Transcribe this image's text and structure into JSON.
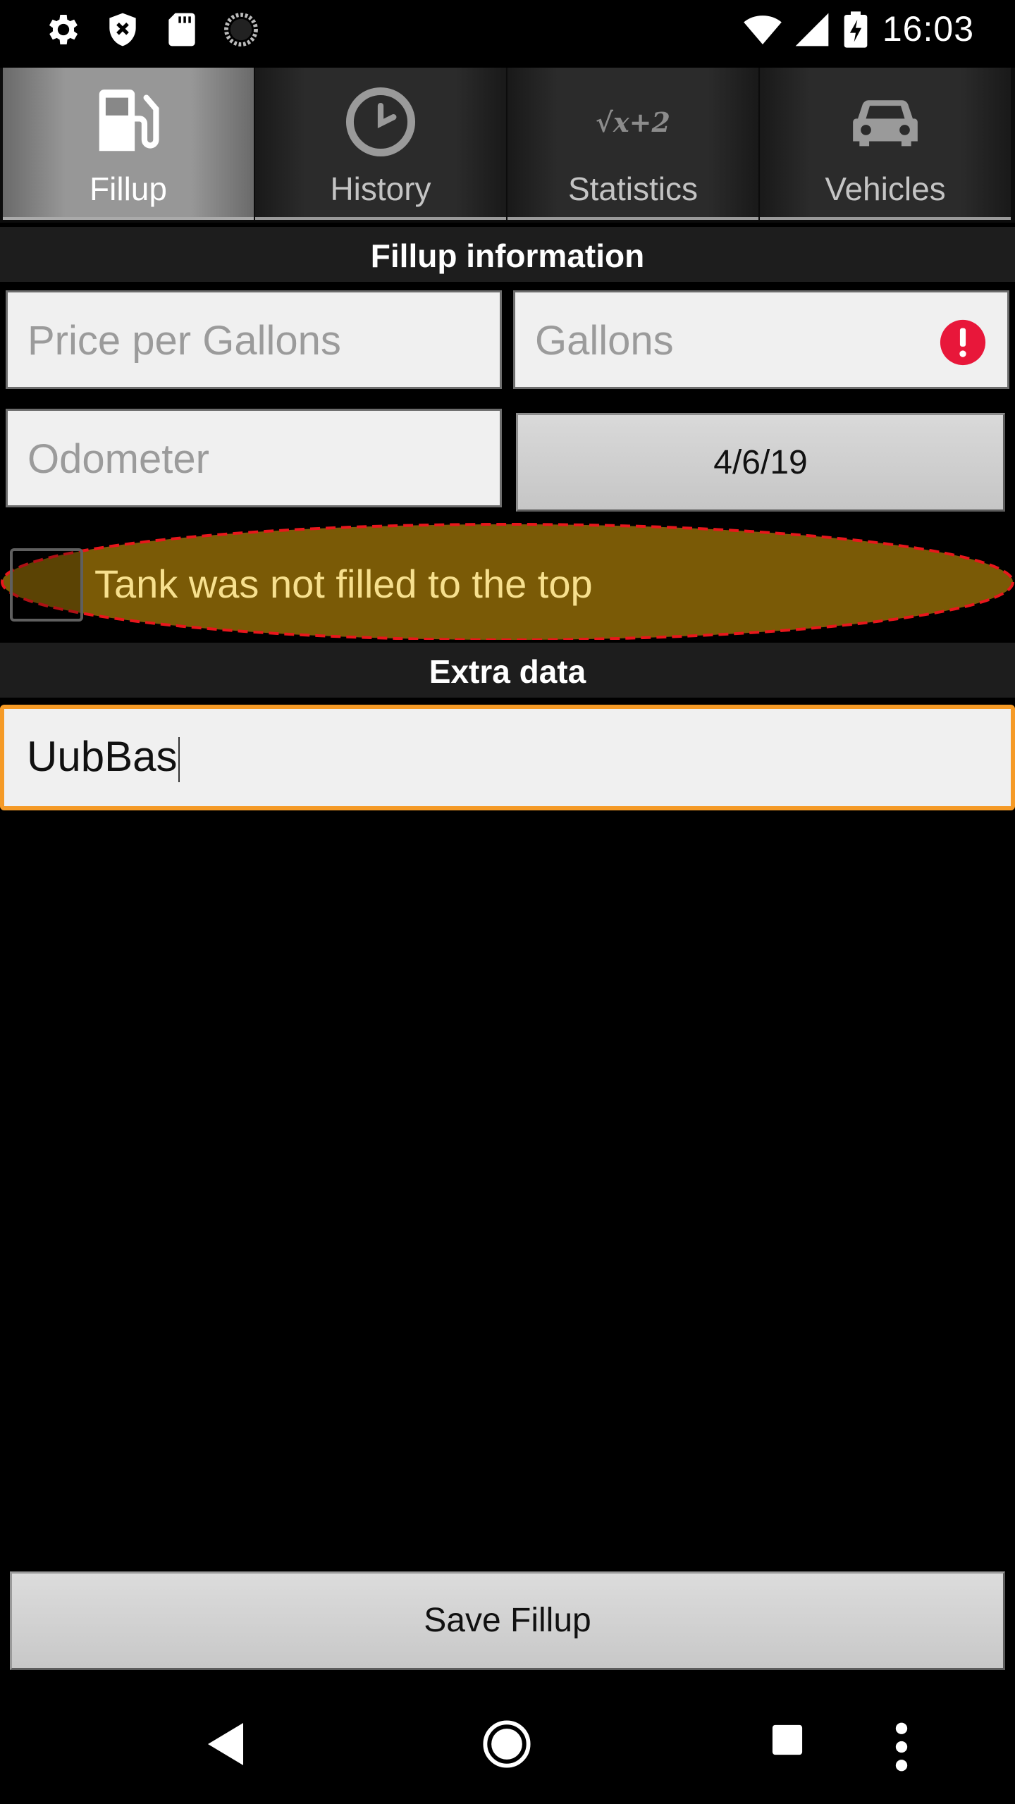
{
  "status_bar": {
    "time": "16:03",
    "left_icons": [
      "settings-gear-icon",
      "shield-close-icon",
      "sd-card-icon",
      "sync-spinner-icon"
    ],
    "right_icons": [
      "wifi-icon",
      "cellular-signal-icon",
      "battery-charging-icon"
    ]
  },
  "tabs": [
    {
      "label": "Fillup",
      "icon": "fuel-pump-icon",
      "active": true
    },
    {
      "label": "History",
      "icon": "clock-icon",
      "active": false
    },
    {
      "label": "Statistics",
      "icon": "formula-icon",
      "active": false,
      "icon_text": "√x+2"
    },
    {
      "label": "Vehicles",
      "icon": "car-icon",
      "active": false
    }
  ],
  "fillup_section": {
    "header": "Fillup information",
    "price_placeholder": "Price per Gallons",
    "gallons_placeholder": "Gallons",
    "odometer_placeholder": "Odometer",
    "date_value": "4/6/19",
    "partial_checkbox_label": "Tank was not filled to the top",
    "partial_checkbox_checked": false
  },
  "extra_section": {
    "header": "Extra data",
    "comment_value": "UubBas"
  },
  "actions": {
    "save_label": "Save Fillup"
  },
  "colors": {
    "focus_border": "#f59a26",
    "error_badge": "#e8173a",
    "highlight_fill": "#7a5a06",
    "highlight_outline": "#e8171c",
    "highlight_text": "#f7e08e"
  }
}
